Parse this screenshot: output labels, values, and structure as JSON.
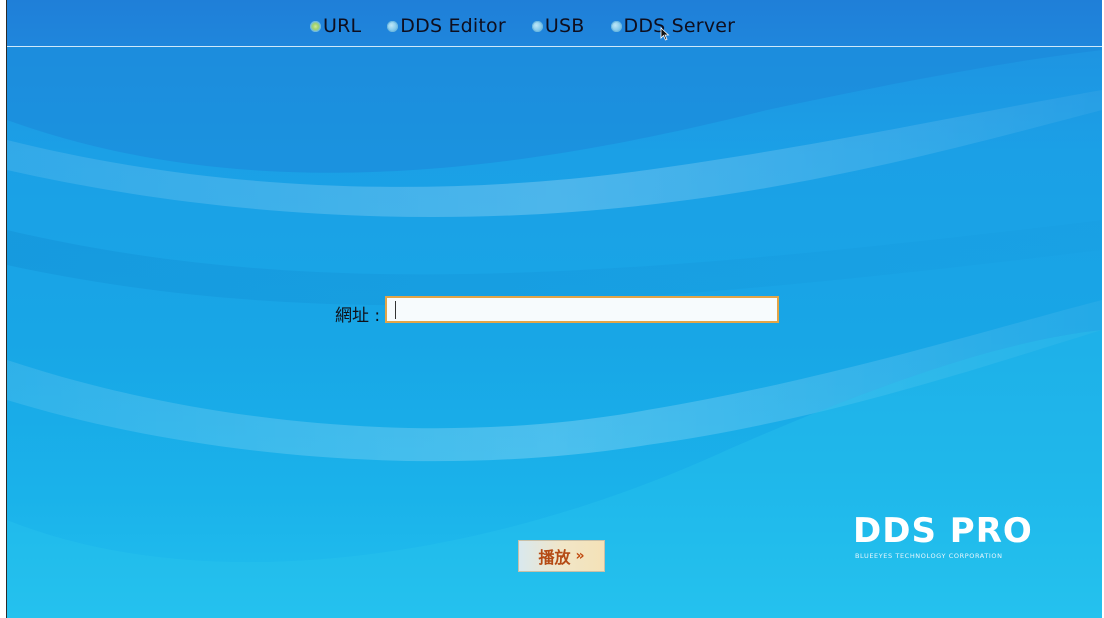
{
  "mode_selector": {
    "options": [
      {
        "label": "URL",
        "checked": true
      },
      {
        "label": "DDS Editor",
        "checked": false
      },
      {
        "label": "USB",
        "checked": false
      },
      {
        "label": "DDS Server",
        "checked": false
      }
    ]
  },
  "url_form": {
    "label": "網址 :",
    "value": "",
    "placeholder": ""
  },
  "play_button": {
    "label": "播放",
    "chevron": "»"
  },
  "brand": {
    "title": "DDS PRO",
    "subtitle": "BLUEEYES TECHNOLOGY CORPORATION"
  },
  "colors": {
    "accent_orange": "#e2a548",
    "play_text": "#b54a14",
    "background_blue": "#1ba0e6"
  }
}
